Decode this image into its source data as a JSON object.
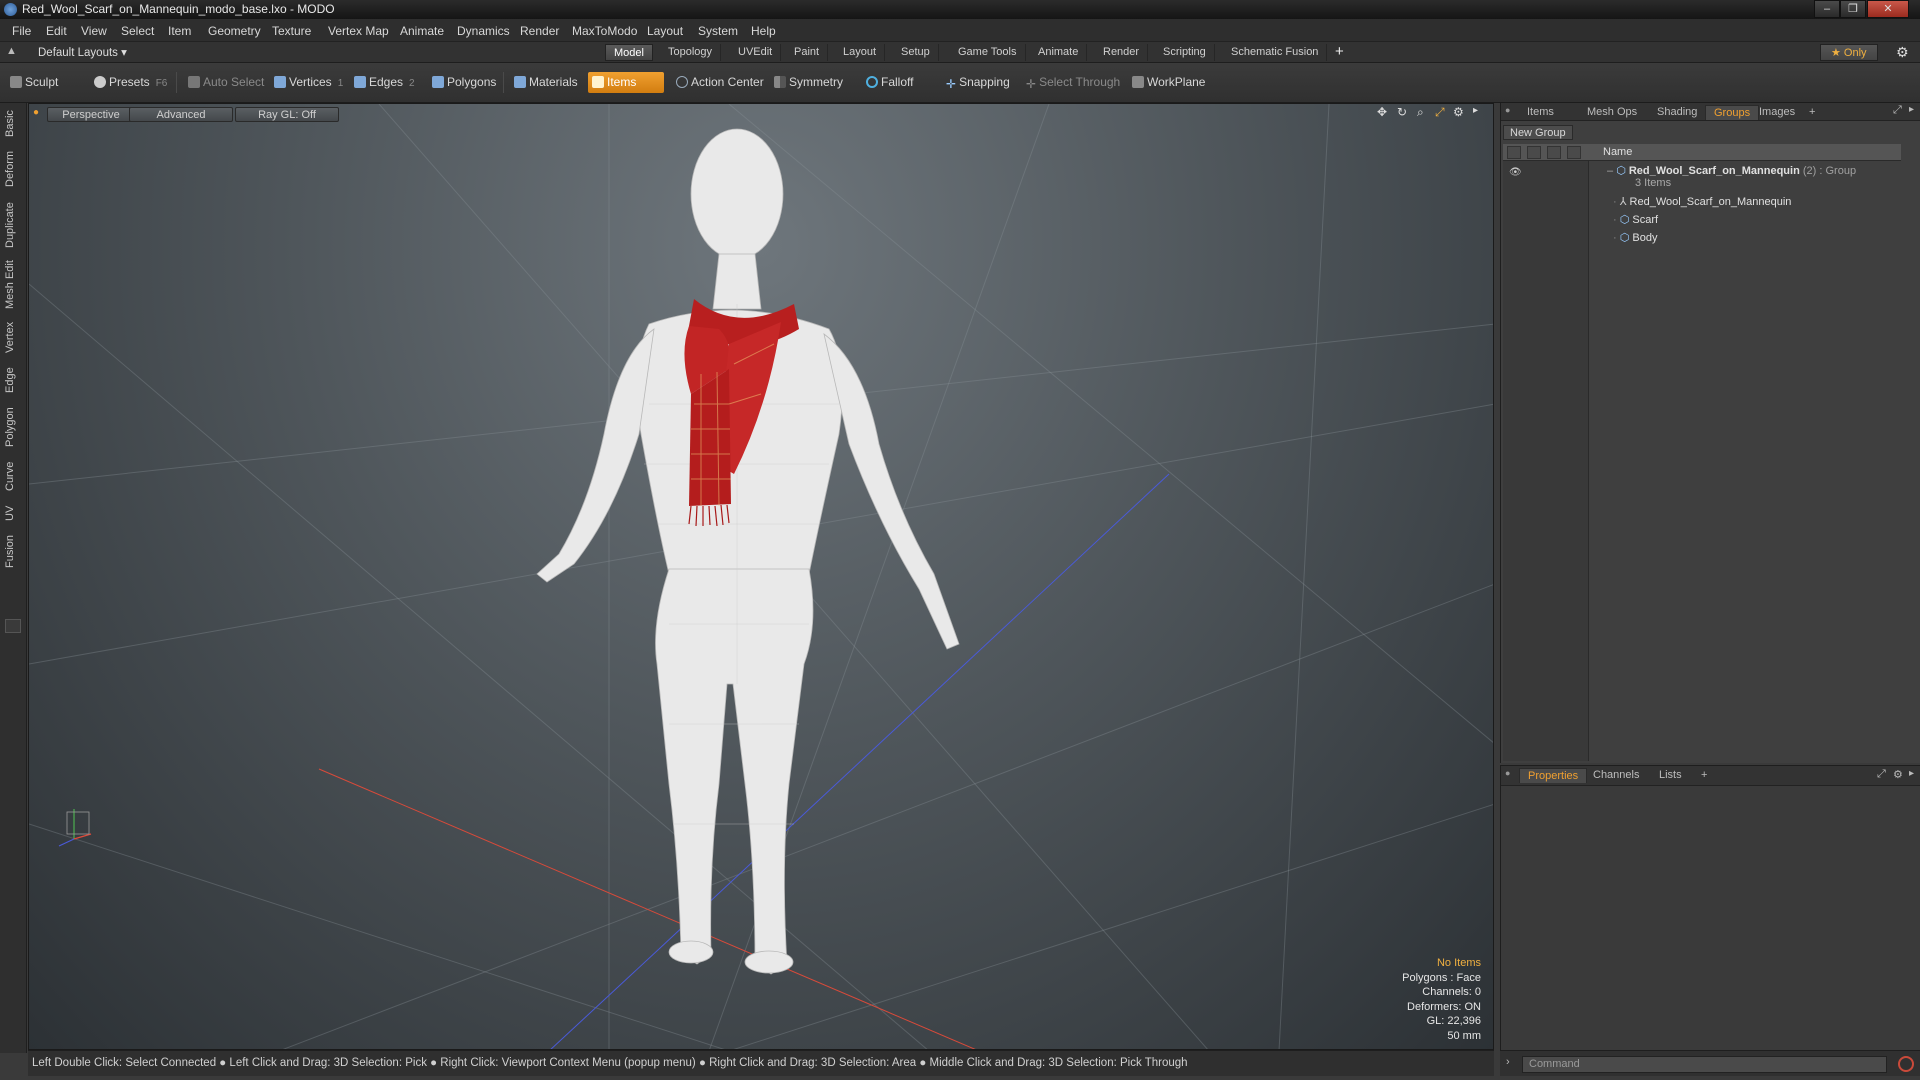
{
  "window": {
    "title": "Red_Wool_Scarf_on_Mannequin_modo_base.lxo - MODO"
  },
  "menu": [
    "File",
    "Edit",
    "View",
    "Select",
    "Item",
    "Geometry",
    "Texture",
    "Vertex Map",
    "Animate",
    "Dynamics",
    "Render",
    "MaxToModo",
    "Layout",
    "System",
    "Help"
  ],
  "layoutbar": {
    "layout_select": "Default Layouts ▾",
    "tabs": [
      "Model",
      "Topology",
      "UVEdit",
      "Paint",
      "Layout",
      "Setup",
      "Game Tools",
      "Animate",
      "Render",
      "Scripting",
      "Schematic Fusion"
    ],
    "active_tab": "Model",
    "add": "+",
    "only": "★ Only"
  },
  "toolbar": {
    "sculpt": "Sculpt",
    "presets": "Presets",
    "presets_key": "F6",
    "auto_select": "Auto Select",
    "vertices": "Vertices",
    "vertices_key": "1",
    "edges": "Edges",
    "edges_key": "2",
    "polygons": "Polygons",
    "materials": "Materials",
    "items": "Items",
    "action_center": "Action Center",
    "symmetry": "Symmetry",
    "falloff": "Falloff",
    "snapping": "Snapping",
    "select_through": "Select Through",
    "workplane": "WorkPlane"
  },
  "lefttabs": [
    "Basic",
    "Deform",
    "Duplicate",
    "Mesh Edit",
    "Vertex",
    "Edge",
    "Polygon",
    "Curve",
    "UV",
    "Fusion"
  ],
  "viewport": {
    "view": "Perspective",
    "shading": "Advanced",
    "raygl": "Ray GL: Off",
    "info": {
      "selection": "No Items",
      "polygons": "Polygons : Face",
      "channels": "Channels: 0",
      "deformers": "Deformers: ON",
      "gl": "GL: 22,396",
      "units": "50 mm"
    }
  },
  "statusbar": {
    "text": "Left Double Click: Select Connected ● Left Click and Drag: 3D Selection: Pick ● Right Click: Viewport Context Menu (popup menu) ● Right Click and Drag: 3D Selection: Area ● Middle Click and Drag: 3D Selection: Pick Through"
  },
  "rightpanel": {
    "tabs": [
      "Items",
      "Mesh Ops",
      "Shading",
      "Groups",
      "Images",
      "+"
    ],
    "active_tab": "Groups",
    "new_group": "New Group",
    "column_name": "Name",
    "group_name": "Red_Wool_Scarf_on_Mannequin",
    "group_count": "(2)",
    "group_type": ": Group",
    "group_items": "3 Items",
    "children": [
      "Red_Wool_Scarf_on_Mannequin",
      "Scarf",
      "Body"
    ]
  },
  "propspanel": {
    "tabs": [
      "Properties",
      "Channels",
      "Lists",
      "+"
    ],
    "active_tab": "Properties"
  },
  "command": {
    "placeholder": "Command"
  }
}
